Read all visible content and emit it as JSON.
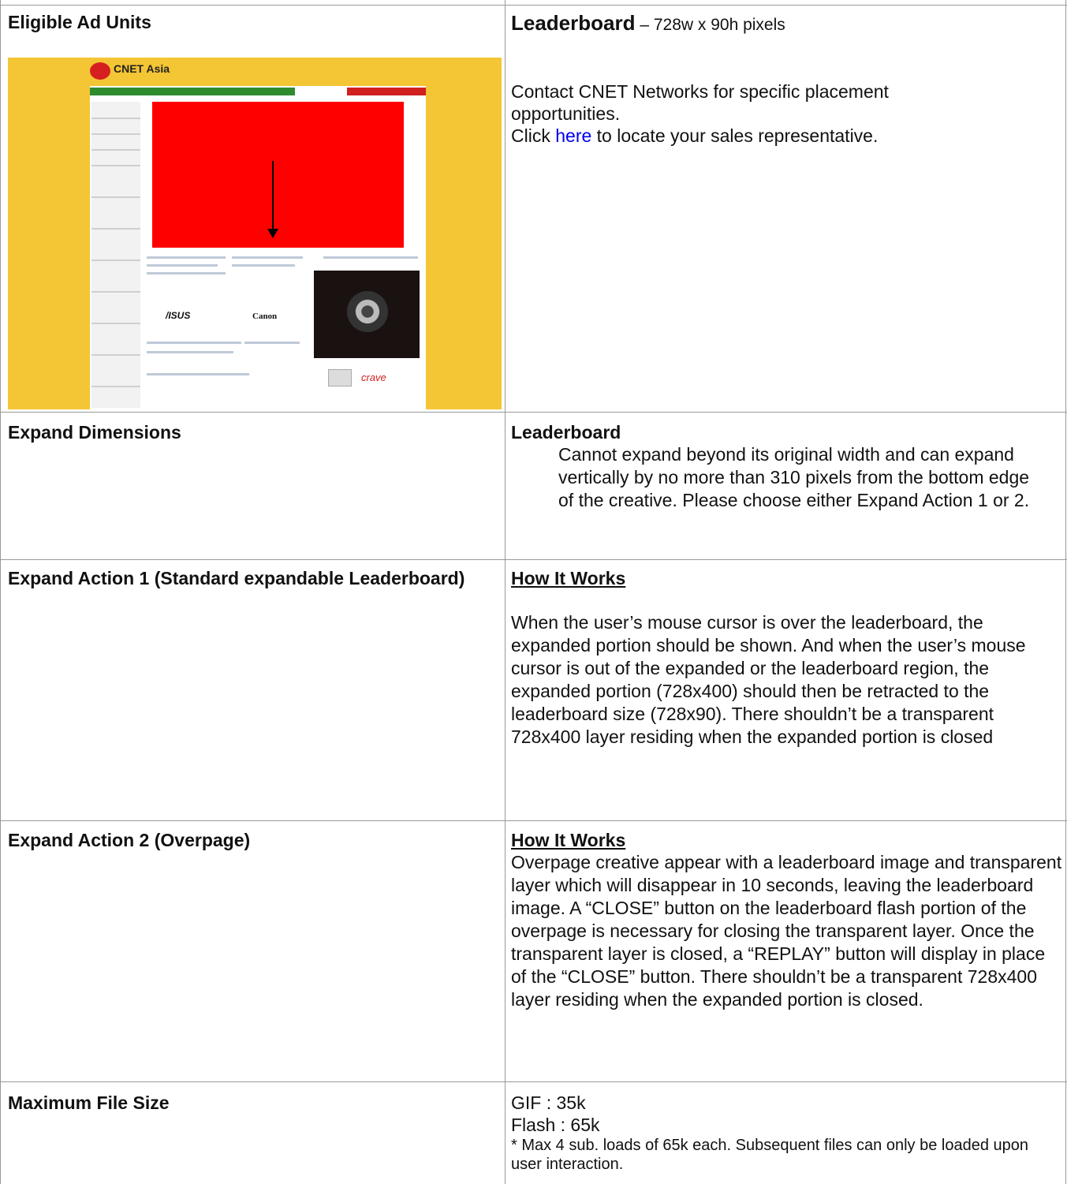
{
  "rows": {
    "eligible": {
      "label": "Eligible Ad Units",
      "unit_name": "Leaderboard",
      "unit_dims": " – 728w x 90h pixels",
      "contact_line": "Contact CNET Networks for specific placement opportunities.",
      "click_prefix": "Click ",
      "click_link": "here",
      "click_suffix": " to locate your sales representative.",
      "preview": {
        "brand": "CNET Asia",
        "logo_text": "cnet",
        "asus": "/ISUS",
        "canon": "Canon",
        "crave": "crave"
      }
    },
    "expand_dims": {
      "label": "Expand Dimensions",
      "heading": "Leaderboard",
      "text": "Cannot expand beyond its original width and can expand vertically by no more than 310 pixels from the bottom edge of the creative. Please choose either Expand Action 1 or 2."
    },
    "action1": {
      "label": "Expand Action 1 (Standard expandable Leaderboard)",
      "heading": "How It Works",
      "text": "When the user’s mouse cursor is over the leaderboard, the expanded portion should be shown. And when the user’s mouse cursor is out of the expanded or the leaderboard region, the expanded portion (728x400) should then be retracted to the leaderboard size (728x90). There shouldn’t be a transparent 728x400 layer residing when the expanded portion is closed"
    },
    "action2": {
      "label": "Expand Action 2 (Overpage)",
      "heading": "How It Works",
      "text": "Overpage creative appear with a leaderboard image and transparent layer which will disappear in 10 seconds, leaving the leaderboard image. A “CLOSE” button on the leaderboard flash portion of the overpage is necessary for closing the transparent layer. Once the transparent layer is closed, a “REPLAY” button will display in place of the “CLOSE” button. There shouldn’t be a transparent 728x400 layer residing when the expanded portion is closed."
    },
    "filesize": {
      "label": "Maximum File Size",
      "gif": "GIF : 35k",
      "flash": "Flash : 65k",
      "note": "* Max 4 sub. loads of 65k each. Subsequent files can only be loaded upon user interaction."
    }
  }
}
